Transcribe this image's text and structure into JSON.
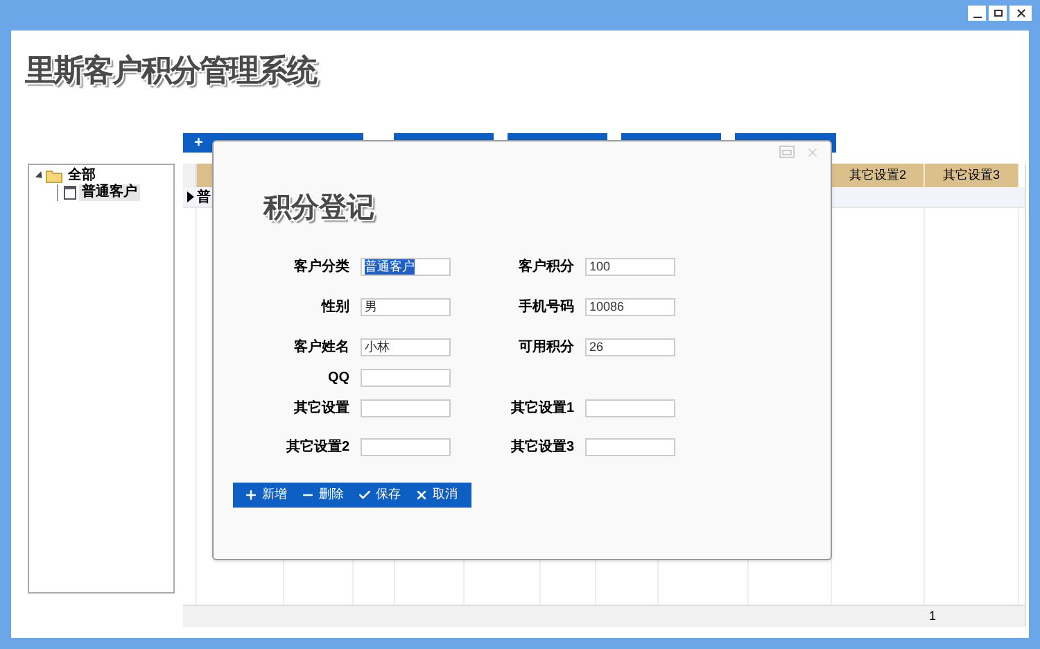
{
  "app": {
    "title": "里斯客户积分管理系统"
  },
  "tree": {
    "items": [
      {
        "label": "全部",
        "expanded": true,
        "selected": false,
        "children": [
          {
            "label": "普通客户",
            "selected": true
          }
        ]
      }
    ]
  },
  "grid": {
    "toolbar_first_label": "+",
    "columns": [
      {
        "label": "其它设置2"
      },
      {
        "label": "其它设置3"
      }
    ],
    "rows": [
      {
        "cell": "普",
        "current": true
      }
    ],
    "pager": {
      "page": "1"
    }
  },
  "dialog": {
    "title": "积分登记",
    "rows": [
      [
        {
          "label": "客户分类",
          "value": "普通客户",
          "highlighted": true
        },
        {
          "label": "客户积分",
          "value": "100",
          "highlighted": false
        }
      ],
      [
        {
          "label": "性别",
          "value": "男",
          "highlighted": false
        },
        {
          "label": "手机号码",
          "value": "10086",
          "highlighted": false
        }
      ],
      [
        {
          "label": "客户姓名",
          "value": "小林",
          "highlighted": false
        },
        {
          "label": "可用积分",
          "value": "26",
          "highlighted": false
        }
      ],
      [
        {
          "label": "QQ"
        }
      ],
      [
        {
          "label": "其它设置"
        },
        {
          "label": "其它设置1"
        }
      ],
      [
        {
          "label": "其它设置2"
        },
        {
          "label": "其它设置3"
        }
      ]
    ],
    "buttons": [
      {
        "kind": "add",
        "label": "新增"
      },
      {
        "kind": "delete",
        "label": "删除"
      },
      {
        "kind": "save",
        "label": "保存"
      },
      {
        "kind": "cancel",
        "label": "取消"
      }
    ]
  }
}
